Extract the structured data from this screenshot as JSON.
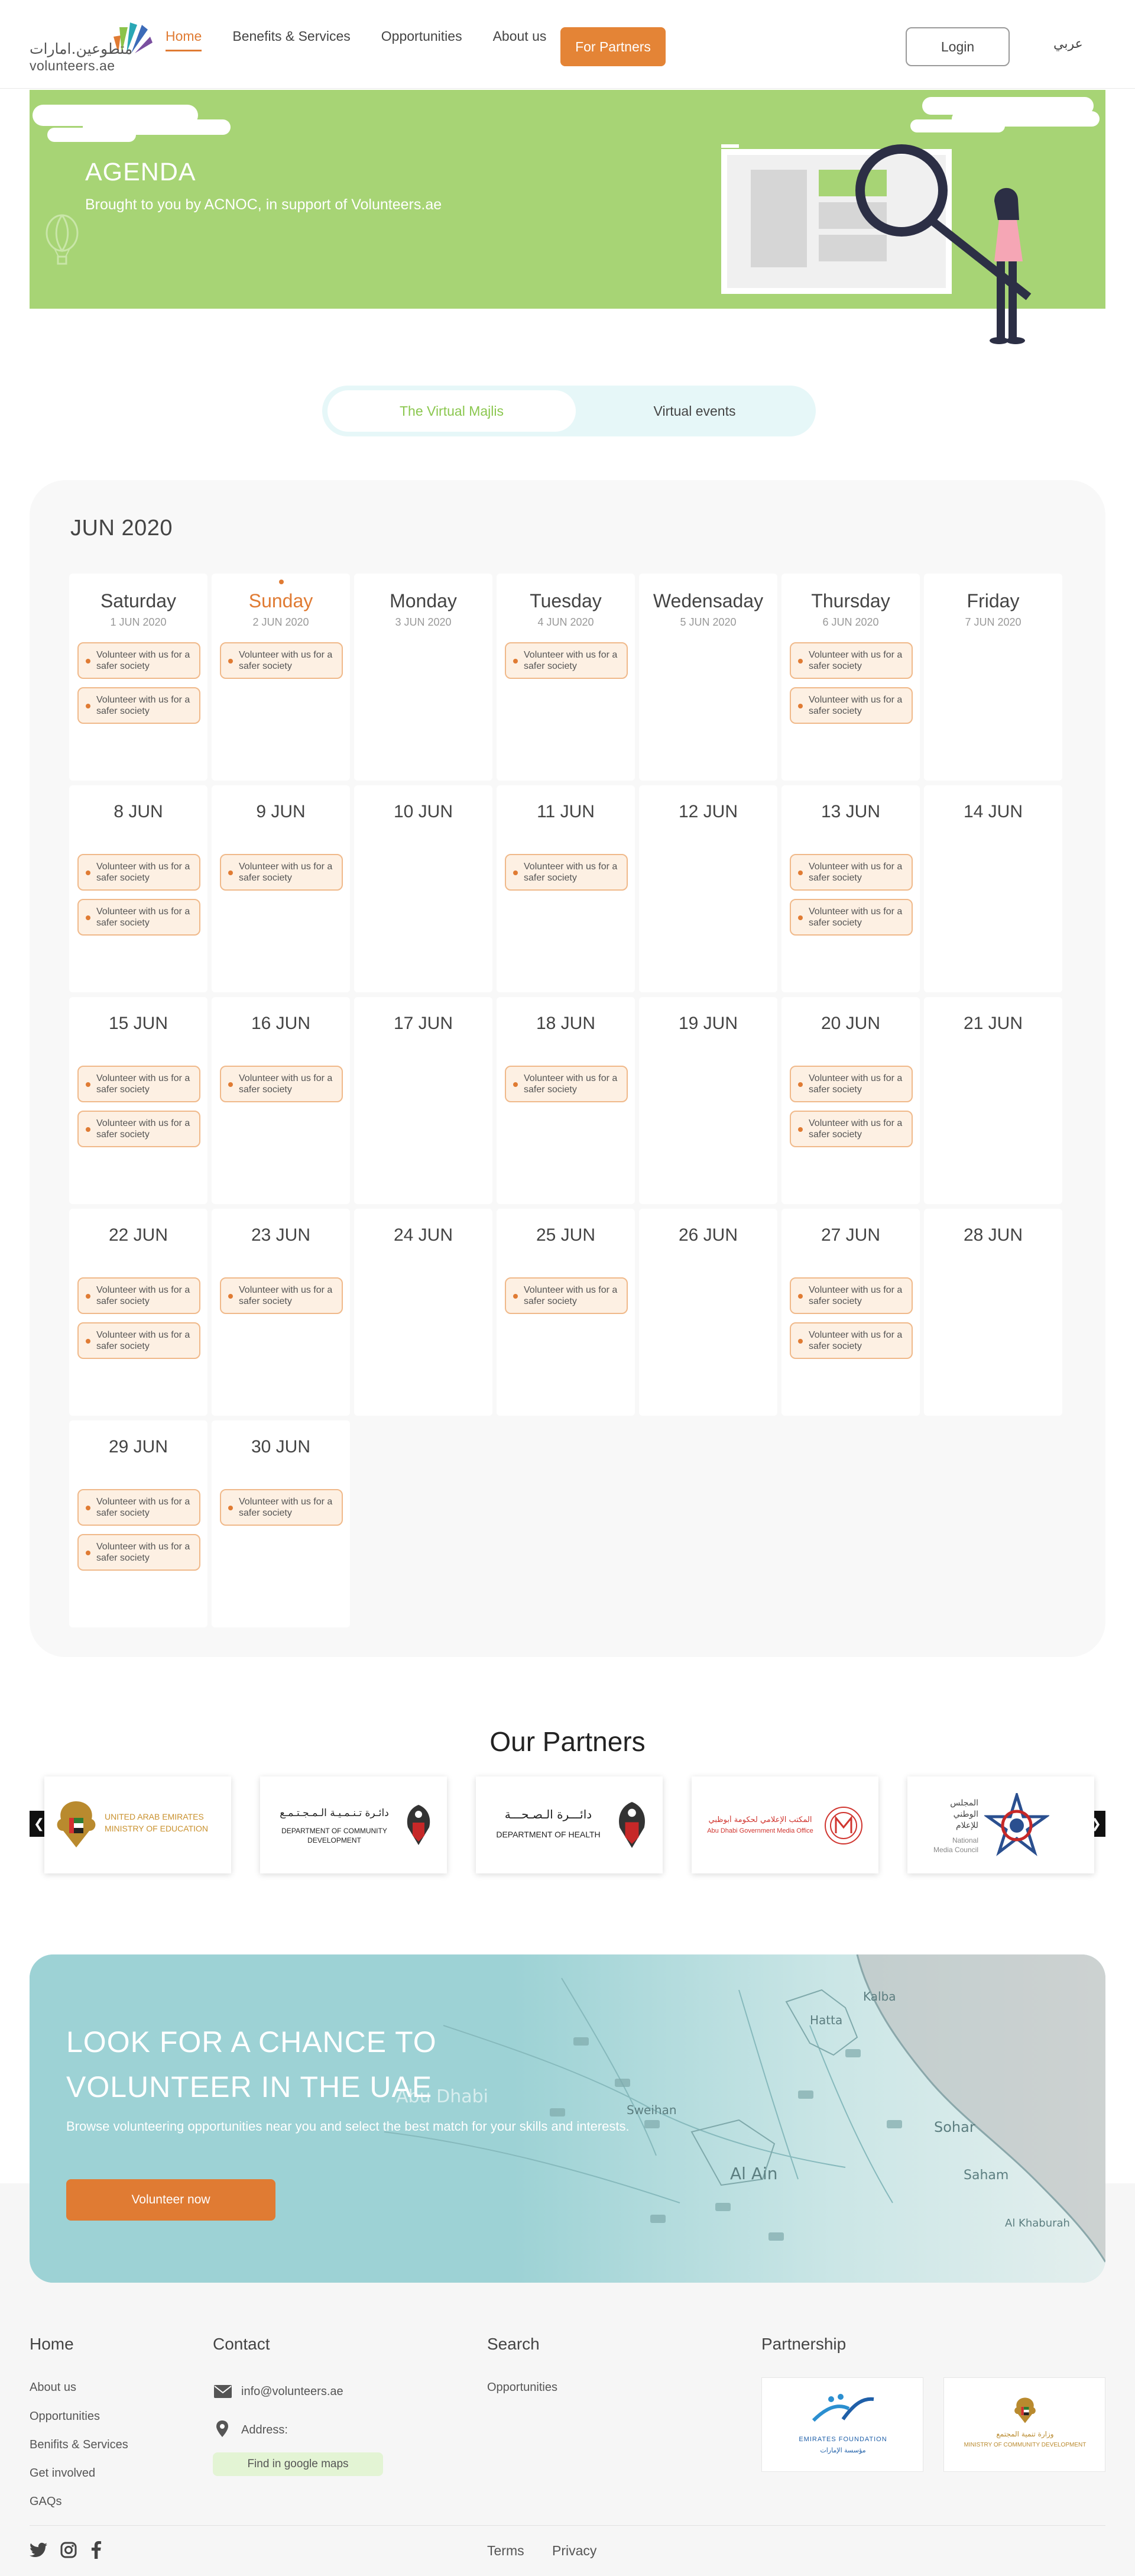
{
  "header": {
    "logo_arabic": "متطوعين.امارات",
    "logo_english": "volunteers.ae",
    "nav": [
      "Home",
      "Benefits & Services",
      "Opportunities",
      "About us"
    ],
    "partners_button": "For Partners",
    "login_button": "Login",
    "language": "عربي",
    "accent_color": "#e07b33"
  },
  "hero": {
    "title": "AGENDA",
    "subtitle": "Brought to you by ACNOC, in support of Volunteers.ae",
    "background_color": "#a7d475"
  },
  "tabs": [
    "The Virtual Majlis",
    "Virtual events"
  ],
  "calendar": {
    "month": "JUN 2020",
    "event_label": "Volunteer with us for a safer society",
    "week1": [
      {
        "day": "Saturday",
        "date": "1 JUN 2020",
        "events": 2
      },
      {
        "day": "Sunday",
        "date": "2 JUN 2020",
        "events": 1
      },
      {
        "day": "Monday",
        "date": "3 JUN 2020",
        "events": 0
      },
      {
        "day": "Tuesday",
        "date": "4 JUN 2020",
        "events": 1
      },
      {
        "day": "Wedensaday",
        "date": "5 JUN 2020",
        "events": 0
      },
      {
        "day": "Thursday",
        "date": "6 JUN 2020",
        "events": 2
      },
      {
        "day": "Friday",
        "date": "7 JUN 2020",
        "events": 0
      }
    ],
    "days": [
      {
        "label": "8 JUN",
        "events": 2
      },
      {
        "label": "9 JUN",
        "events": 1
      },
      {
        "label": "10 JUN",
        "events": 0
      },
      {
        "label": "11 JUN",
        "events": 1
      },
      {
        "label": "12 JUN",
        "events": 0
      },
      {
        "label": "13 JUN",
        "events": 2
      },
      {
        "label": "14 JUN",
        "events": 0
      },
      {
        "label": "15 JUN",
        "events": 2
      },
      {
        "label": "16 JUN",
        "events": 1
      },
      {
        "label": "17 JUN",
        "events": 0
      },
      {
        "label": "18 JUN",
        "events": 1
      },
      {
        "label": "19 JUN",
        "events": 0
      },
      {
        "label": "20 JUN",
        "events": 2
      },
      {
        "label": "21 JUN",
        "events": 0
      },
      {
        "label": "22 JUN",
        "events": 2
      },
      {
        "label": "23 JUN",
        "events": 1
      },
      {
        "label": "24 JUN",
        "events": 0
      },
      {
        "label": "25 JUN",
        "events": 1
      },
      {
        "label": "26 JUN",
        "events": 0
      },
      {
        "label": "27 JUN",
        "events": 2
      },
      {
        "label": "28 JUN",
        "events": 0
      },
      {
        "label": "29 JUN",
        "events": 2
      },
      {
        "label": "30 JUN",
        "events": 1
      }
    ]
  },
  "partners": {
    "title": "Our Partners",
    "logos": [
      {
        "line1": "UNITED ARAB EMIRATES",
        "line2": "MINISTRY OF EDUCATION",
        "color": "#c9912e"
      },
      {
        "line1": "دائـرة تـنـمـيـة الـمـجـتـمـع",
        "line2": "DEPARTMENT OF COMMUNITY DEVELOPMENT",
        "color": "#222222"
      },
      {
        "line1": "دائـــرة الـصـحـــة",
        "line2": "DEPARTMENT OF HEALTH",
        "color": "#222222"
      },
      {
        "line1": "المكتب الإعلامي لحكومة أبوظبي",
        "line2": "Abu Dhabi Government Media Office",
        "color": "#d0352f"
      },
      {
        "line1": "المجلس الوطني للإعلام",
        "line2": "National Media Council",
        "color": "#555555"
      }
    ]
  },
  "banner": {
    "title": "LOOK FOR A CHANCE TO VOLUNTEER IN THE UAE",
    "subtitle": "Browse volunteering opportunities near you and select the best match for your skills and interests.",
    "button": "Volunteer now",
    "map_labels": [
      "Abu Dhabi",
      "Sweihan",
      "Al Ain",
      "Hatta",
      "Kalba",
      "Sohar",
      "Saham",
      "Al Khaburah"
    ]
  },
  "footer": {
    "home_heading": "Home",
    "home_links": [
      "About us",
      "Opportunities",
      "Benifits & Services",
      "Get involved",
      "GAQs"
    ],
    "contact_heading": "Contact",
    "email": "info@volunteers.ae",
    "address_label": "Address:",
    "maps_button": "Find in google maps",
    "search_heading": "Search",
    "search_links": [
      "Opportunities"
    ],
    "partnership_heading": "Partnership",
    "partner_logos": [
      {
        "line1": "EMIRATES FOUNDATION",
        "line2": "مؤسسة الإمارات"
      },
      {
        "line1": "وزارة تنمية المجتمع",
        "line2": "MINISTRY OF COMMUNITY DEVELOPMENT"
      }
    ],
    "bottom_links": [
      "Terms",
      "Privacy"
    ]
  }
}
